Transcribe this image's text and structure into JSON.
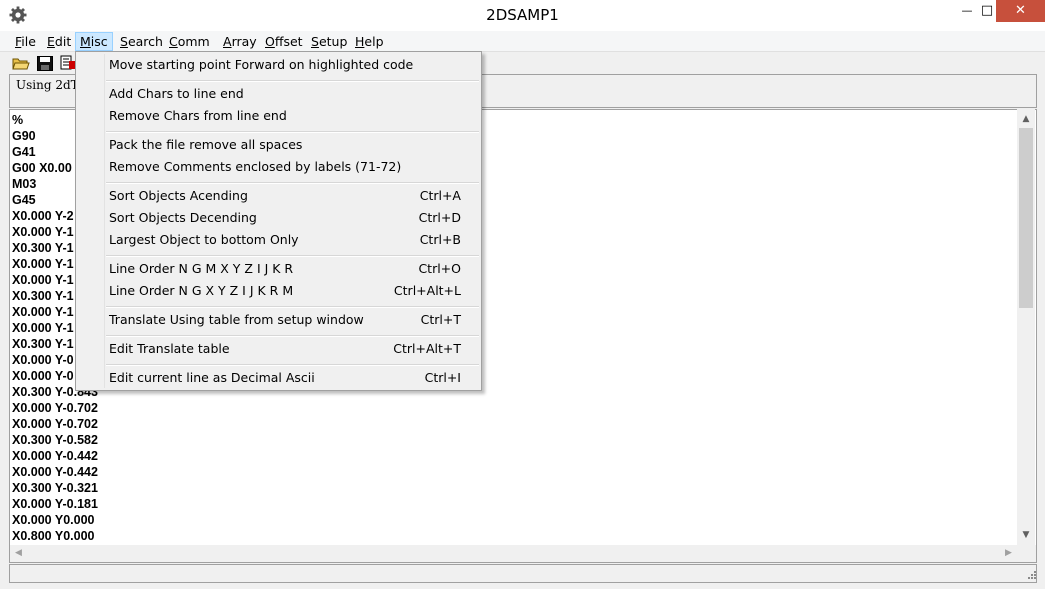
{
  "window": {
    "title": "2DSAMP1",
    "min_glyph": "—",
    "max_glyph": "□",
    "close_glyph": "✕"
  },
  "menubar": {
    "items": [
      {
        "key": "F",
        "rest": "ile"
      },
      {
        "key": "E",
        "rest": "dit"
      },
      {
        "key": "M",
        "rest": "isc"
      },
      {
        "key": "S",
        "rest": "earch"
      },
      {
        "key": "C",
        "rest": "omm"
      },
      {
        "key": "A",
        "rest": "rray"
      },
      {
        "key": "O",
        "rest": "ffset"
      },
      {
        "key": "S",
        "rest": "etup"
      },
      {
        "key": "H",
        "rest": "elp"
      }
    ]
  },
  "status": {
    "text": "Using 2dTor"
  },
  "misc_menu": {
    "items": [
      {
        "label": "Move starting point Forward on highlighted code",
        "shortcut": ""
      },
      {
        "label": "Add Chars  to line end",
        "shortcut": ""
      },
      {
        "label": "Remove Chars from line end",
        "shortcut": ""
      },
      {
        "label": "Pack the file remove all spaces",
        "shortcut": ""
      },
      {
        "label": "Remove Comments enclosed by labels (71-72)",
        "shortcut": ""
      },
      {
        "label": "Sort Objects Acending",
        "shortcut": "Ctrl+A"
      },
      {
        "label": "Sort Objects Decending",
        "shortcut": "Ctrl+D"
      },
      {
        "label": "Largest Object to bottom Only",
        "shortcut": "Ctrl+B"
      },
      {
        "label": "Line Order N G M X Y Z I J K R",
        "shortcut": "Ctrl+O"
      },
      {
        "label": "Line Order N G X Y Z I J K R M",
        "shortcut": "Ctrl+Alt+L"
      },
      {
        "label": "Translate Using table from setup window",
        "shortcut": "Ctrl+T"
      },
      {
        "label": "Edit Translate table",
        "shortcut": "Ctrl+Alt+T"
      },
      {
        "label": "Edit current line as Decimal Ascii",
        "shortcut": "Ctrl+I"
      }
    ]
  },
  "editor": {
    "lines": [
      "%",
      "G90",
      "G41",
      "G00 X0.00",
      "M03",
      "G45",
      "X0.000 Y-2",
      "X0.000 Y-1",
      "X0.300 Y-1",
      "X0.000 Y-1",
      "X0.000 Y-1",
      "X0.300 Y-1",
      "X0.000 Y-1",
      "X0.000 Y-1",
      "X0.300 Y-1",
      "X0.000 Y-0",
      "X0.000 Y-0",
      "X0.300 Y-0.843",
      "X0.000 Y-0.702",
      "X0.000 Y-0.702",
      "X0.300 Y-0.582",
      "X0.000 Y-0.442",
      "X0.000 Y-0.442",
      "X0.300 Y-0.321",
      "X0.000 Y-0.181",
      "X0.000 Y0.000",
      "X0.800 Y0.000"
    ]
  }
}
